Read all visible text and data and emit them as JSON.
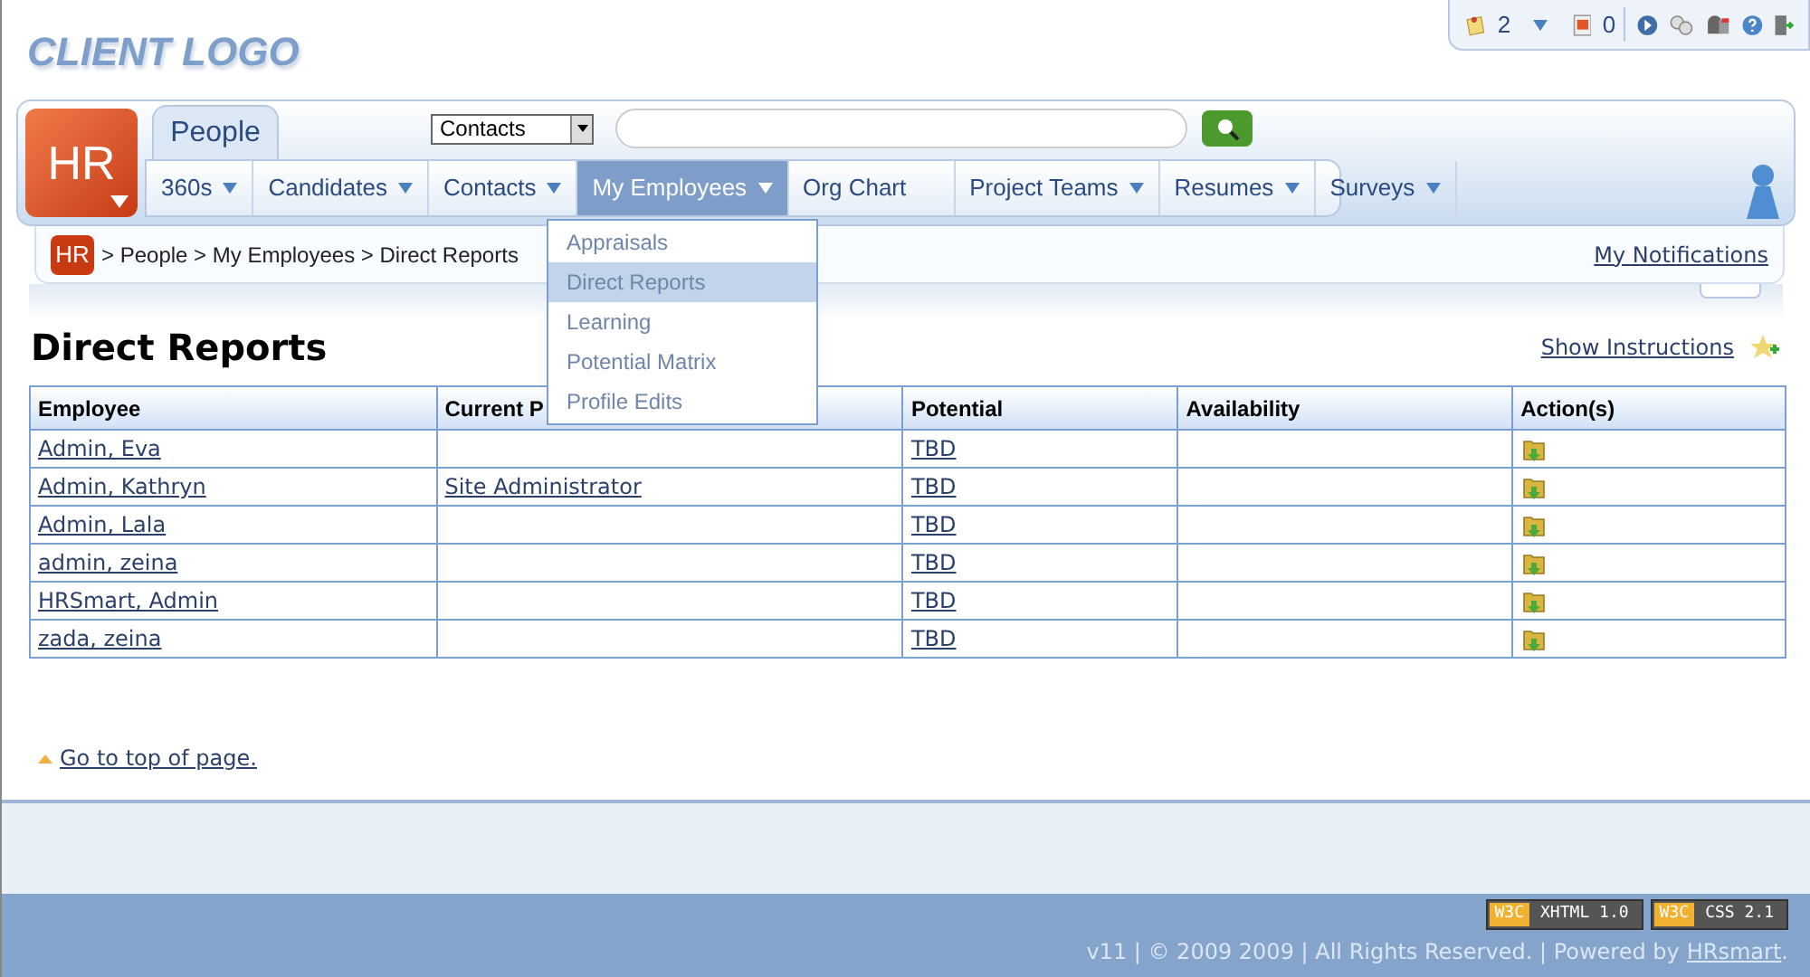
{
  "logo": "CLIENT LOGO",
  "toolbar": {
    "tasks_count": "2",
    "alerts_count": "0"
  },
  "header": {
    "logo": "HR",
    "tab": {
      "label": "People",
      "selected": true
    },
    "search_scope": "Contacts"
  },
  "nav": [
    {
      "label": "360s",
      "dropdown": true,
      "selected": false
    },
    {
      "label": "Candidates",
      "dropdown": true,
      "selected": false
    },
    {
      "label": "Contacts",
      "dropdown": true,
      "selected": false
    },
    {
      "label": "My Employees",
      "dropdown": true,
      "selected": true
    },
    {
      "label": "Org Chart",
      "dropdown": false,
      "selected": false
    },
    {
      "label": "Project Teams",
      "dropdown": true,
      "selected": false
    },
    {
      "label": "Resumes",
      "dropdown": true,
      "selected": false
    },
    {
      "label": "Surveys",
      "dropdown": true,
      "selected": false
    }
  ],
  "menu": [
    {
      "label": "Appraisals",
      "selected": false
    },
    {
      "label": "Direct Reports",
      "selected": true
    },
    {
      "label": "Learning",
      "selected": false
    },
    {
      "label": "Potential Matrix",
      "selected": false
    },
    {
      "label": "Profile Edits",
      "selected": false
    }
  ],
  "breadcrumb": {
    "logo": "HR",
    "path": "> People > My Employees > Direct Reports",
    "notifications": "My Notifications"
  },
  "page": {
    "title": "Direct Reports",
    "instructions": "Show Instructions"
  },
  "table": {
    "columns": [
      "Employee",
      "Current P",
      "Potential",
      "Availability",
      "Action(s)"
    ],
    "rows": [
      {
        "employee": "Admin, Eva",
        "position": "",
        "potential": "TBD"
      },
      {
        "employee": "Admin, Kathryn",
        "position": "Site Administrator",
        "potential": "TBD"
      },
      {
        "employee": "Admin, Lala",
        "position": "",
        "potential": "TBD"
      },
      {
        "employee": "admin, zeina",
        "position": "",
        "potential": "TBD"
      },
      {
        "employee": "HRSmart, Admin",
        "position": "",
        "potential": "TBD"
      },
      {
        "employee": "zada, zeina",
        "position": "",
        "potential": "TBD"
      }
    ]
  },
  "top_link": "Go to top of page.",
  "footer": {
    "badges": [
      {
        "mark": "W3C",
        "label": "XHTML 1.0"
      },
      {
        "mark": "W3C",
        "label": "CSS 2.1"
      }
    ],
    "text": "v11 | © 2009 2009 | All Rights Reserved. | Powered by",
    "link": "HRsmart",
    "suffix": "."
  }
}
